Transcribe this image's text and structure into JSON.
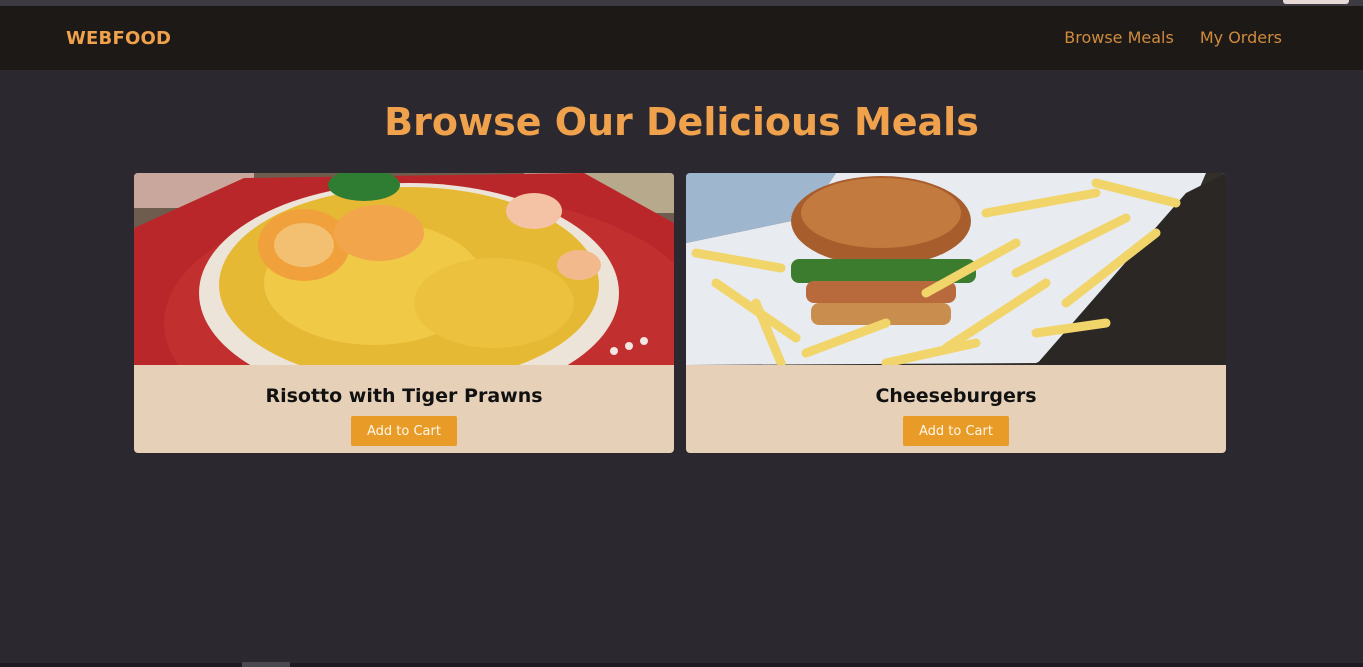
{
  "navbar": {
    "brand": "WEBFOOD",
    "links": [
      {
        "label": "Browse Meals"
      },
      {
        "label": "My Orders"
      }
    ]
  },
  "page": {
    "title": "Browse Our Delicious Meals"
  },
  "meals": [
    {
      "name": "Risotto with Tiger Prawns",
      "button_label": "Add to Cart"
    },
    {
      "name": "Cheeseburgers",
      "button_label": "Add to Cart"
    }
  ],
  "colors": {
    "background": "#2b2830",
    "navbar": "#1d1917",
    "accent": "#f0a14c",
    "card": "#e6d0b8",
    "button": "#e89b26"
  }
}
